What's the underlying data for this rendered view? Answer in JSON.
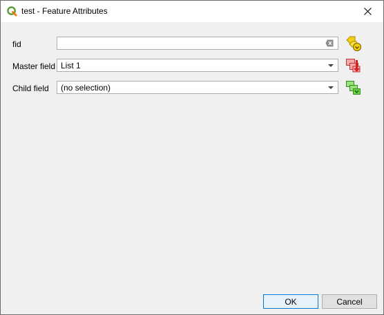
{
  "window": {
    "title": "test - Feature Attributes"
  },
  "form": {
    "fid": {
      "label": "fid",
      "value": ""
    },
    "master": {
      "label": "Master field",
      "value": "List 1"
    },
    "child": {
      "label": "Child field",
      "value": "(no selection)"
    }
  },
  "buttons": {
    "ok": "OK",
    "cancel": "Cancel"
  },
  "icons": {
    "app": "qgis-icon",
    "close": "close-icon",
    "clear": "clear-text-icon",
    "fid_action": "expression-icon",
    "master_action": "data-defined-red-icon",
    "child_action": "data-defined-green-icon"
  },
  "colors": {
    "accent": "#0078d7",
    "icon_yellow": "#f3d10f",
    "icon_red": "#e53b3b",
    "icon_green": "#5fcf3e"
  }
}
